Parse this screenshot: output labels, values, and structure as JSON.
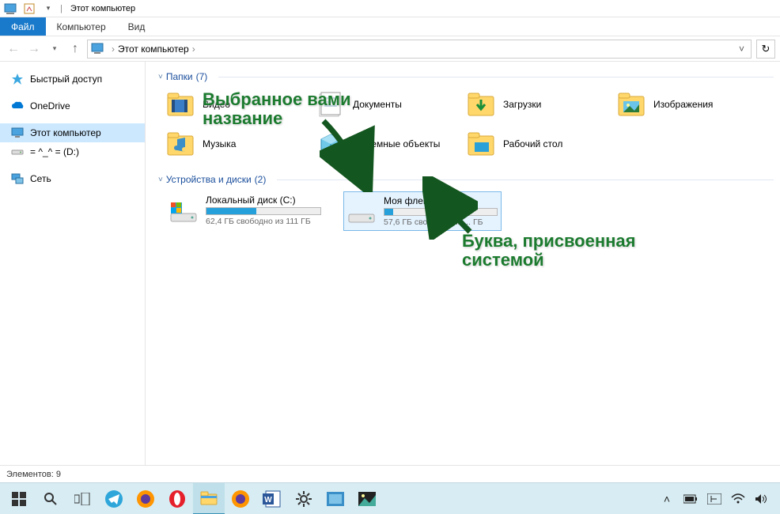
{
  "window": {
    "title": "Этот компьютер"
  },
  "ribbon": {
    "file": "Файл",
    "tabs": [
      "Компьютер",
      "Вид"
    ]
  },
  "breadcrumb": {
    "location": "Этот компьютер"
  },
  "sidebar": {
    "items": [
      {
        "label": "Быстрый доступ",
        "icon": "star",
        "color": "#3aa7e0"
      },
      {
        "label": "OneDrive",
        "icon": "cloud",
        "color": "#0078d4"
      },
      {
        "label": "Этот компьютер",
        "icon": "monitor",
        "color": "#4a90c8",
        "selected": true
      },
      {
        "label": "= ^_^ = (D:)",
        "icon": "drive",
        "color": "#888"
      },
      {
        "label": "Сеть",
        "icon": "network",
        "color": "#4a90c8"
      }
    ]
  },
  "groups": {
    "folders": {
      "title": "Папки",
      "count": "(7)"
    },
    "devices": {
      "title": "Устройства и диски",
      "count": "(2)"
    }
  },
  "folders": [
    {
      "label": "Видео",
      "icon": "video"
    },
    {
      "label": "Документы",
      "icon": "docs"
    },
    {
      "label": "Загрузки",
      "icon": "downloads"
    },
    {
      "label": "Изображения",
      "icon": "images"
    },
    {
      "label": "Музыка",
      "icon": "music"
    },
    {
      "label": "Объемные объекты",
      "icon": "3d"
    },
    {
      "label": "Рабочий стол",
      "icon": "desktop"
    }
  ],
  "drives": [
    {
      "name": "Локальный диск (C:)",
      "free": "62,4 ГБ свободно из 111 ГБ",
      "fill_pct": 44,
      "icon": "win"
    },
    {
      "name": "Моя флешка (D:)",
      "free": "57,6 ГБ свободно из ... ГБ",
      "fill_pct": 8,
      "icon": "usb",
      "selected": true
    }
  ],
  "annotations": {
    "a1_line1": "Выбранное вами",
    "a1_line2": "название",
    "a2_line1": "Буква, присвоенная",
    "a2_line2": "системой"
  },
  "status": {
    "text": "Элементов: 9"
  },
  "taskbar": {
    "tray": {
      "up": "˄"
    }
  }
}
